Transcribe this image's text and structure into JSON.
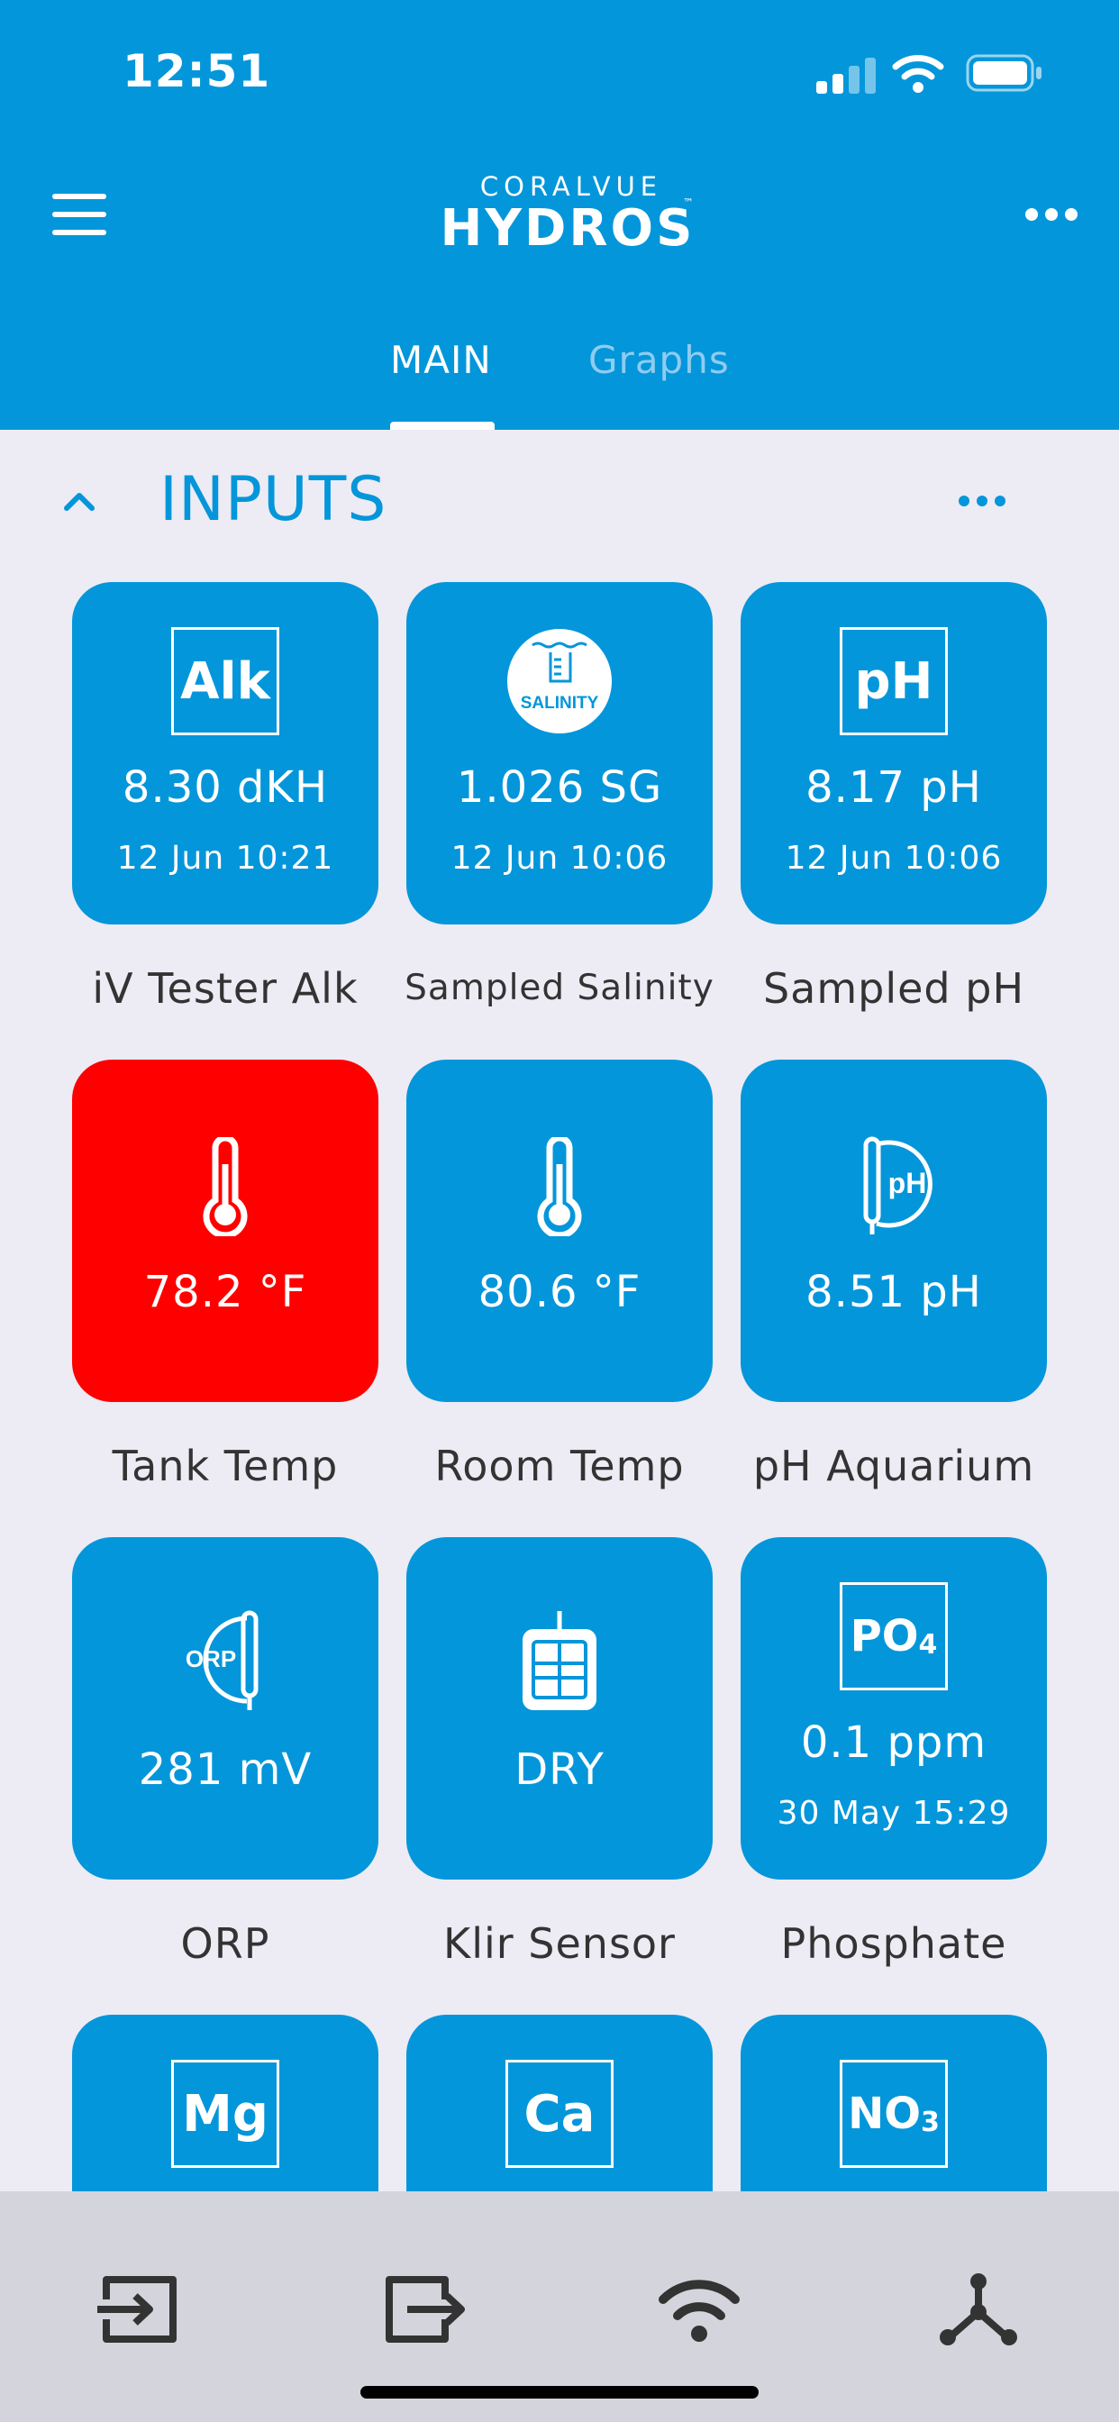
{
  "status_bar": {
    "time": "12:51"
  },
  "header": {
    "brand_small": "CORALVUE",
    "brand_big": "HYDROS",
    "brand_tm": "™"
  },
  "tabs": [
    {
      "label": "MAIN",
      "active": true
    },
    {
      "label": "Graphs",
      "active": false
    }
  ],
  "section": {
    "title": "INPUTS"
  },
  "tiles": [
    {
      "label": "iV Tester Alk",
      "icon": "Alk",
      "value": "8.30 dKH",
      "date": "12 Jun 10:21"
    },
    {
      "label": "Sampled Salinity",
      "icon": "SALINITY",
      "value": "1.026 SG",
      "date": "12 Jun 10:06"
    },
    {
      "label": "Sampled pH",
      "icon": "pH",
      "value": "8.17 pH",
      "date": "12 Jun 10:06"
    },
    {
      "label": "Tank Temp",
      "icon": "thermometer-icon",
      "value": "78.2 °F",
      "alert": true
    },
    {
      "label": "Room Temp",
      "icon": "thermometer-icon",
      "value": "80.6 °F"
    },
    {
      "label": "pH Aquarium",
      "icon": "pH",
      "value": "8.51 pH"
    },
    {
      "label": "ORP",
      "icon": "ORP",
      "value": "281 mV"
    },
    {
      "label": "Klir Sensor",
      "icon": "klir-sensor-icon",
      "value": "DRY"
    },
    {
      "label": "Phosphate",
      "icon": "PO",
      "icon_sub": "4",
      "value": "0.1 ppm",
      "date": "30 May 15:29"
    },
    {
      "icon": "Mg"
    },
    {
      "icon": "Ca"
    },
    {
      "icon": "NO",
      "icon_sub": "3"
    }
  ],
  "colors": {
    "accent": "#0496DA",
    "alert": "#FF0000",
    "background": "#EDEBF4"
  }
}
